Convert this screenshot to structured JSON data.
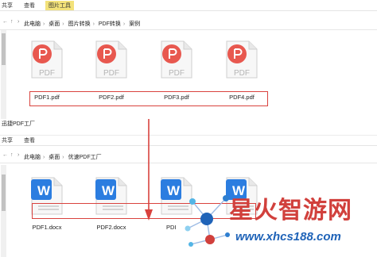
{
  "window1": {
    "ribbon_tabs": [
      "共享",
      "查看"
    ],
    "ribbon_active_tab": "图片工具",
    "breadcrumb": [
      "此电脑",
      "桌面",
      "图片转换",
      "PDF转换",
      "案例"
    ],
    "files": [
      "PDF1.pdf",
      "PDF2.pdf",
      "PDF3.pdf",
      "PDF4.pdf"
    ],
    "file_type_label": "PDF"
  },
  "window2": {
    "title": "迅捷PDF工厂",
    "ribbon_tabs": [
      "共享",
      "查看"
    ],
    "breadcrumb": [
      "此电脑",
      "桌面",
      "优速PDF工厂"
    ],
    "files": [
      "PDF1.docx",
      "PDF2.docx",
      "PDI",
      ""
    ],
    "file_type_label": "W"
  },
  "watermark": {
    "title": "星火智游网",
    "url": "www.xhcs188.com"
  },
  "colors": {
    "pdf_red": "#e8584f",
    "word_blue": "#2b7de0",
    "annotation_red": "#d9423e",
    "watermark_red": "#d1403c",
    "watermark_blue": "#1f63b8"
  }
}
